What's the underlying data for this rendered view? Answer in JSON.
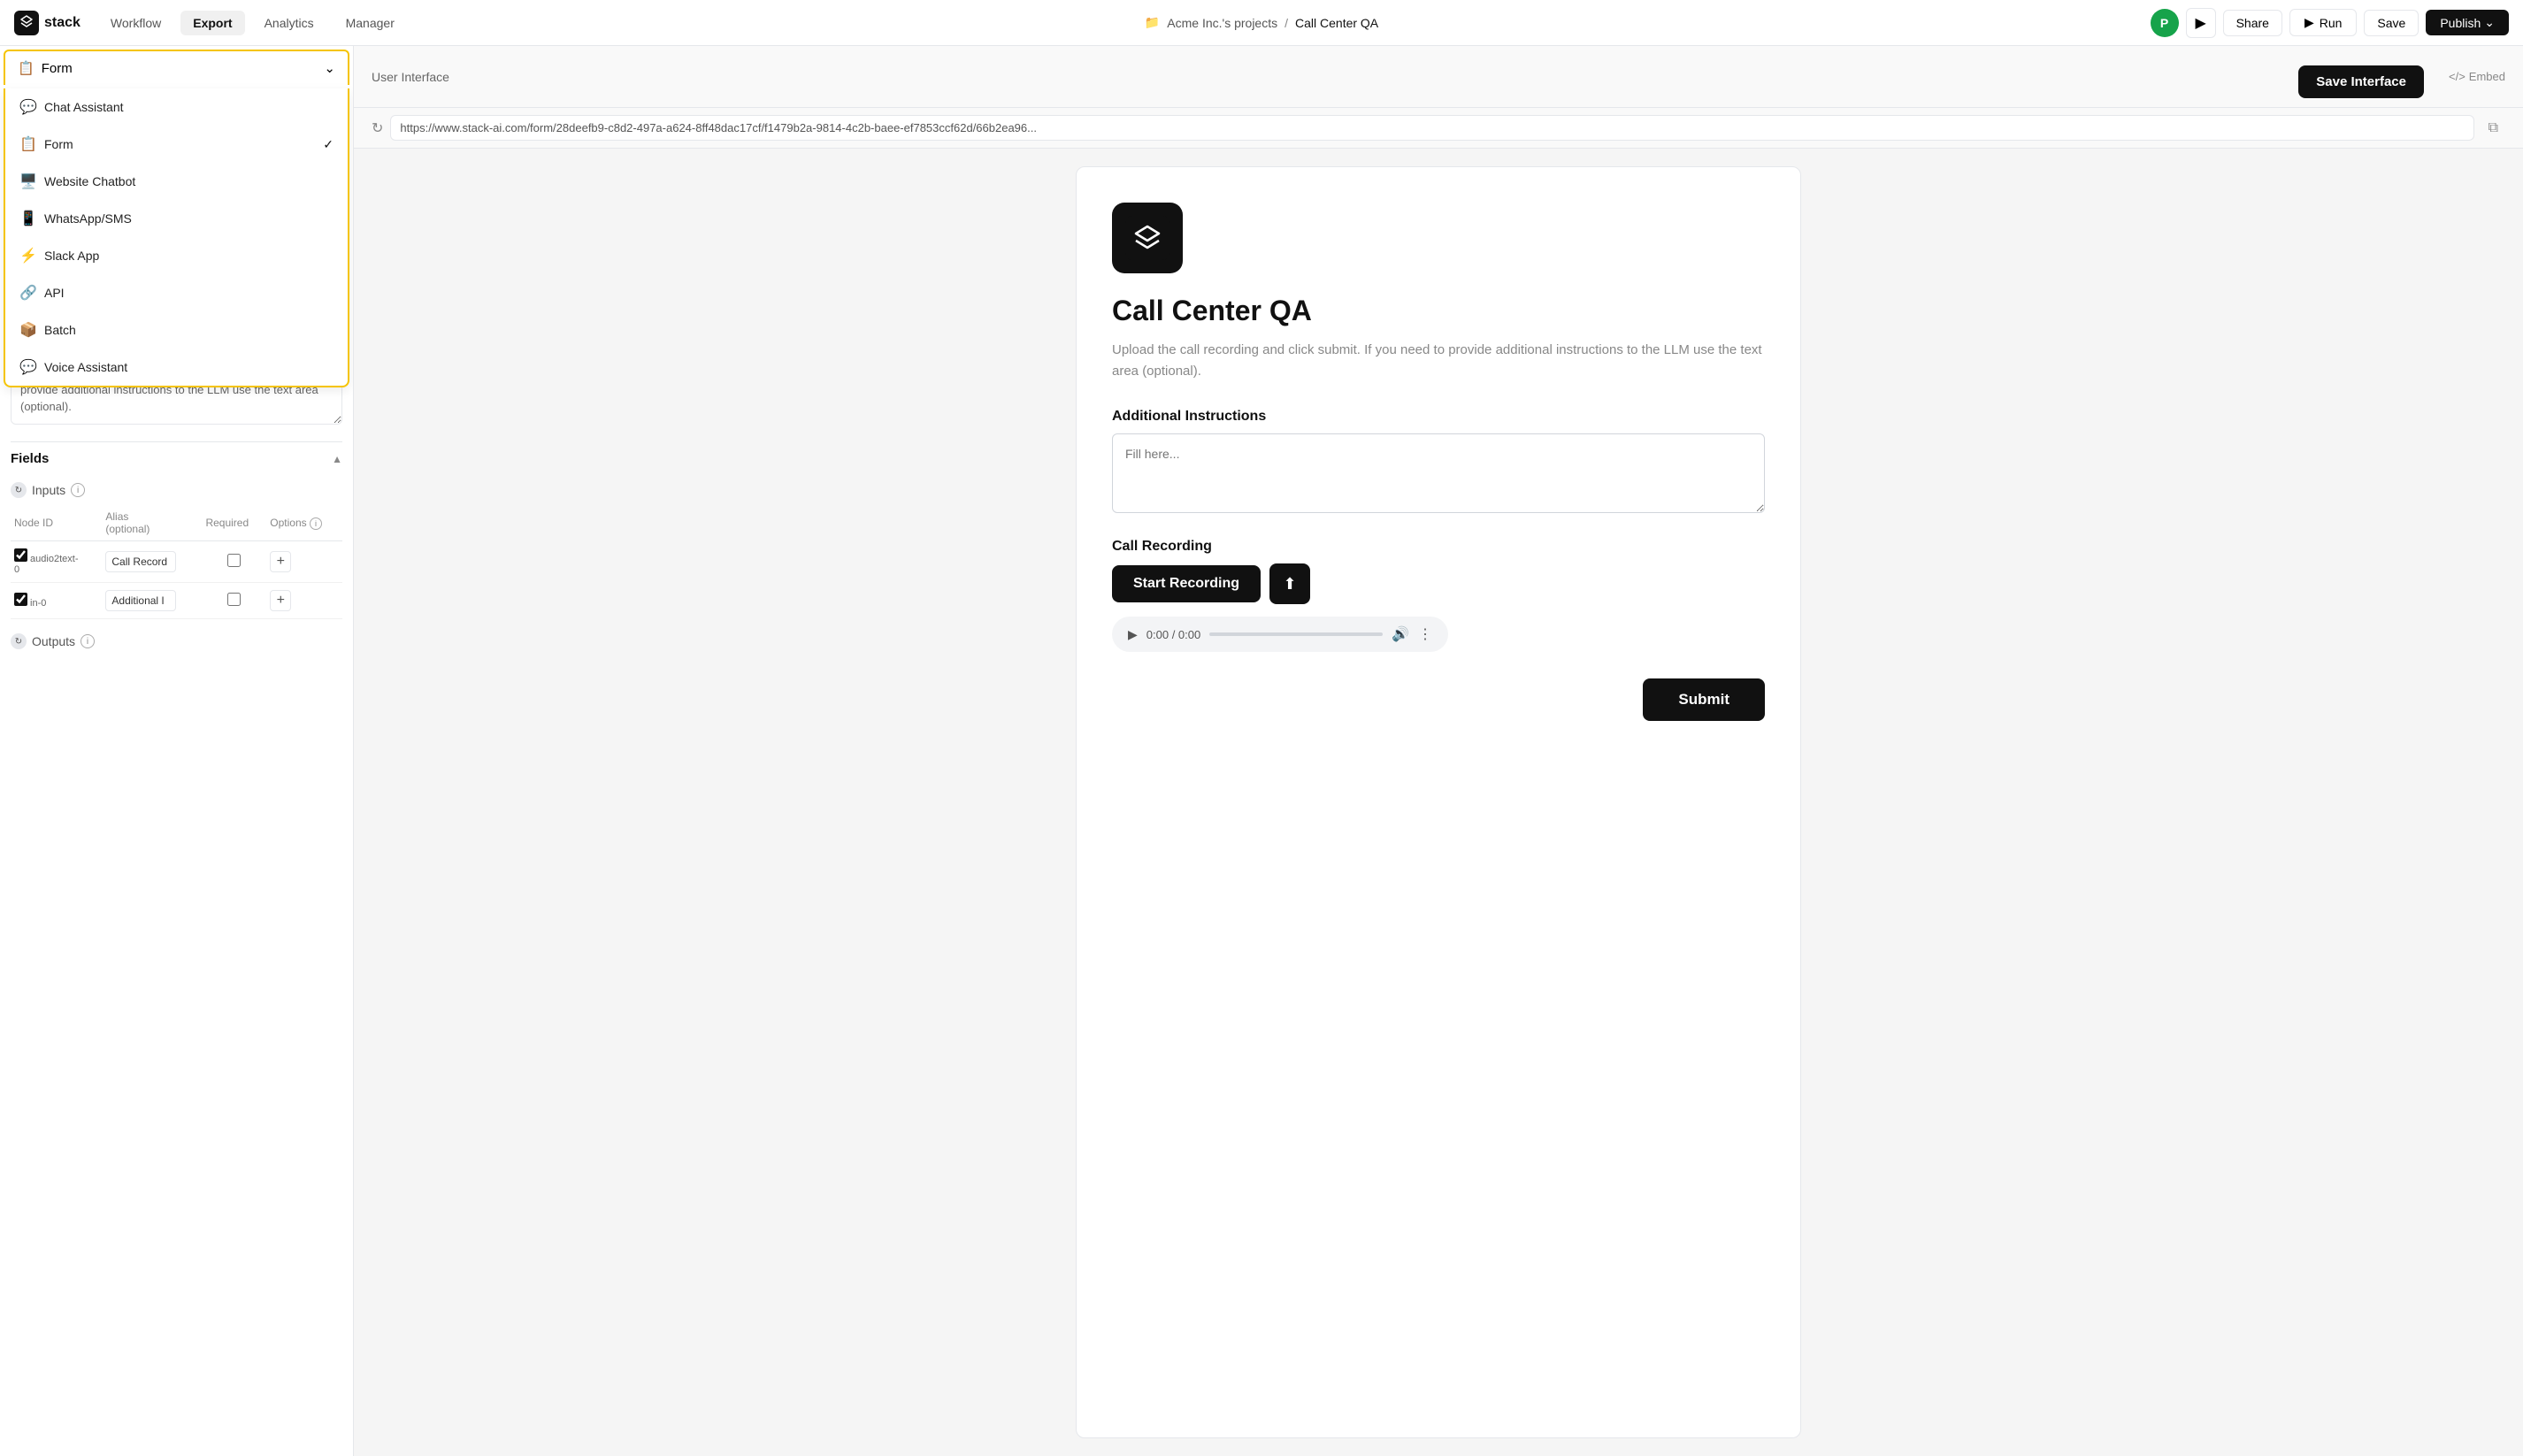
{
  "app": {
    "logo_text": "stack",
    "nav": {
      "items": [
        {
          "label": "Workflow",
          "active": false
        },
        {
          "label": "Export",
          "active": true
        },
        {
          "label": "Analytics",
          "active": false
        },
        {
          "label": "Manager",
          "active": false
        }
      ]
    },
    "breadcrumb": {
      "project": "Acme Inc.'s projects",
      "separator": "/",
      "current": "Call Center QA"
    },
    "toolbar": {
      "share_label": "Share",
      "run_label": "Run",
      "save_label": "Save",
      "publish_label": "Publish",
      "avatar_initial": "P"
    }
  },
  "sidebar": {
    "dropdown_label": "Form",
    "menu_items": [
      {
        "id": "chat-assistant",
        "label": "Chat Assistant",
        "icon": "💬",
        "selected": false
      },
      {
        "id": "form",
        "label": "Form",
        "icon": "📋",
        "selected": true
      },
      {
        "id": "website-chatbot",
        "label": "Website Chatbot",
        "icon": "🖥️",
        "selected": false
      },
      {
        "id": "whatsapp-sms",
        "label": "WhatsApp/SMS",
        "icon": "📱",
        "selected": false
      },
      {
        "id": "slack-app",
        "label": "Slack App",
        "icon": "⚡",
        "selected": false
      },
      {
        "id": "api",
        "label": "API",
        "icon": "🔗",
        "selected": false
      },
      {
        "id": "batch",
        "label": "Batch",
        "icon": "📦",
        "selected": false
      },
      {
        "id": "voice-assistant",
        "label": "Voice Assistant",
        "icon": "💬",
        "selected": false
      }
    ],
    "description": "Upload the call recording and click Submit. If you need to provide additional instructions to the LLM use the text area (optional).",
    "fields_label": "Fields",
    "inputs_label": "Inputs",
    "table": {
      "headers": [
        "Node ID",
        "Alias\n(optional)",
        "Required",
        "Options"
      ],
      "rows": [
        {
          "node_id": "audio2text-\n0",
          "alias": "Call Record",
          "required": false,
          "checked": true
        },
        {
          "node_id": "in-0",
          "alias": "Additional I",
          "required": false,
          "checked": true
        }
      ]
    },
    "outputs_label": "Outputs"
  },
  "interface": {
    "label": "User Interface",
    "embed_label": "Embed",
    "url": "https://www.stack-ai.com/form/28deefb9-c8d2-497a-a624-8ff48dac17cf/f1479b2a-9814-4c2b-baee-ef7853ccf62d/66b2ea96...",
    "save_interface_label": "Save Interface"
  },
  "preview": {
    "title": "Call Center QA",
    "description": "Upload the call recording and click submit. If you need to provide additional instructions to the LLM use the text area (optional).",
    "additional_instructions_label": "Additional Instructions",
    "additional_instructions_placeholder": "Fill here...",
    "call_recording_label": "Call Recording",
    "start_recording_label": "Start Recording",
    "time_display": "0:00 / 0:00",
    "submit_label": "Submit"
  },
  "icons": {
    "play": "▶",
    "volume": "🔊",
    "more": "⋮",
    "upload": "⬆",
    "embed_code": "</>",
    "refresh": "↻",
    "copy": "⧉",
    "folder": "📁",
    "chevron_down": "⌄",
    "check": "✓",
    "play_triangle": "▶"
  },
  "colors": {
    "accent": "#111111",
    "border_highlight": "#f5c400",
    "green_avatar": "#16a34a"
  }
}
